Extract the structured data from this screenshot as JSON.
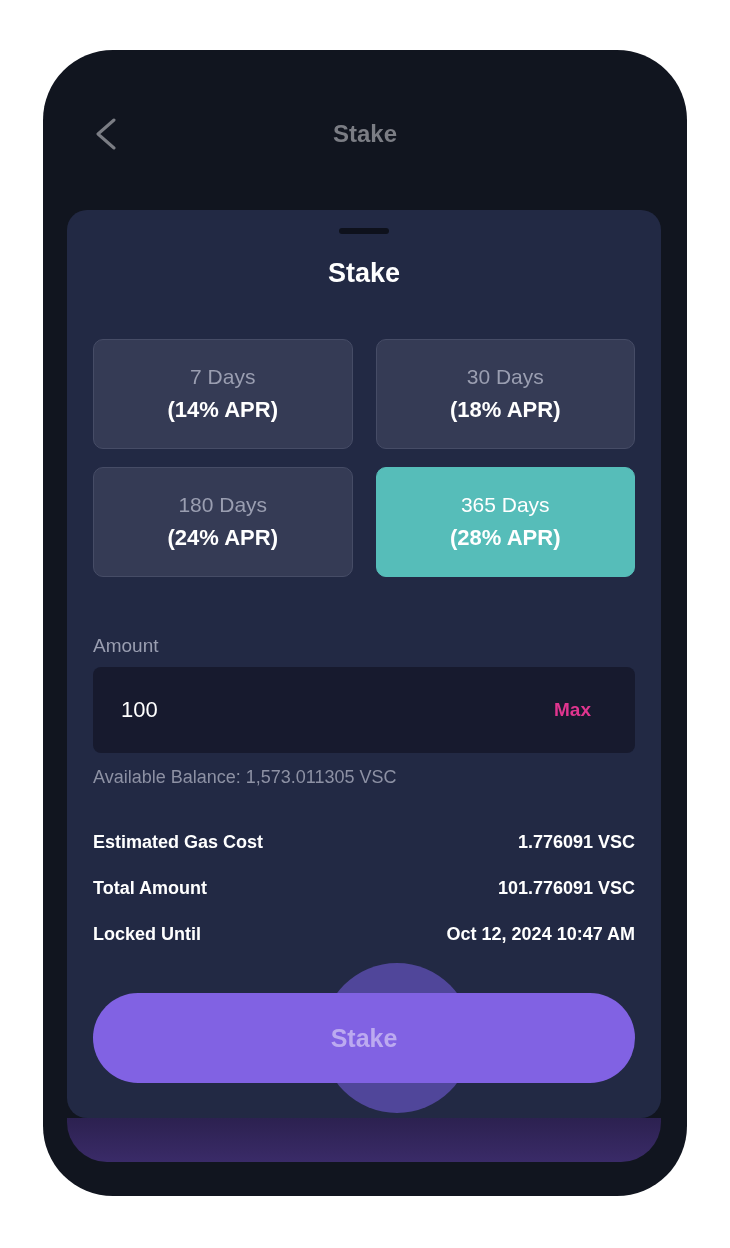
{
  "header": {
    "title": "Stake"
  },
  "sheet": {
    "title": "Stake",
    "durations": [
      {
        "days": "7 Days",
        "apr": "(14% APR)",
        "selected": false
      },
      {
        "days": "30 Days",
        "apr": "(18% APR)",
        "selected": false
      },
      {
        "days": "180 Days",
        "apr": "(24% APR)",
        "selected": false
      },
      {
        "days": "365 Days",
        "apr": "(28% APR)",
        "selected": true
      }
    ],
    "amount": {
      "label": "Amount",
      "value": "100",
      "action": "Max"
    },
    "balance": "Available Balance: 1,573.011305 VSC",
    "summary": [
      {
        "label": "Estimated Gas Cost",
        "value": "1.776091 VSC"
      },
      {
        "label": "Total Amount",
        "value": "101.776091 VSC"
      },
      {
        "label": "Locked Until",
        "value": "Oct 12, 2024 10:47 AM"
      }
    ],
    "button": "Stake"
  }
}
